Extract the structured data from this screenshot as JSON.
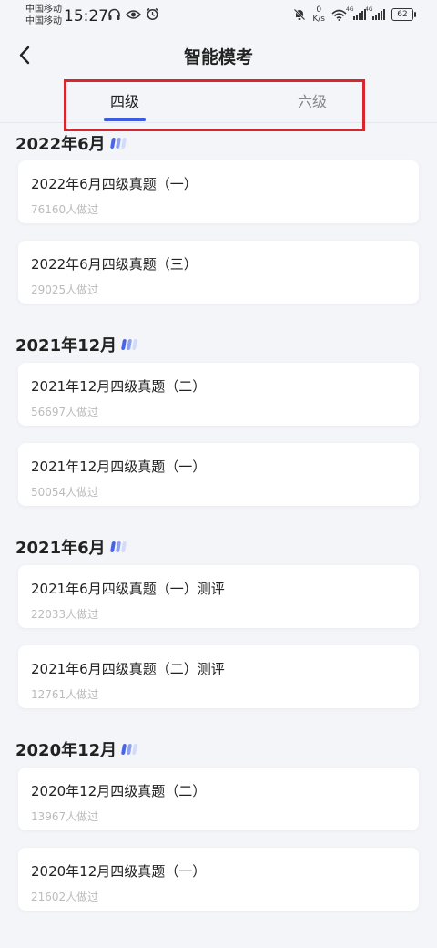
{
  "status_bar": {
    "carrier_1": "中国移动",
    "carrier_2": "中国移动",
    "time": "15:27",
    "net_speed_value": "0",
    "net_speed_unit": "K/s",
    "signal_label_1": "4G",
    "signal_label_2": "4G",
    "battery": "62"
  },
  "header": {
    "title": "智能模考"
  },
  "tabs": [
    {
      "label": "四级",
      "active": true
    },
    {
      "label": "六级",
      "active": false
    }
  ],
  "colors": {
    "accent": "#3d5ce0",
    "highlight": "#d9262e",
    "bar_1": "#4a64e6",
    "bar_2": "#8fa2f0",
    "bar_3": "#d3dbfb"
  },
  "sections": [
    {
      "title": "2022年6月",
      "items": [
        {
          "title": "2022年6月四级真题（一）",
          "count": "76160人做过"
        },
        {
          "title": "2022年6月四级真题（三）",
          "count": "29025人做过"
        }
      ]
    },
    {
      "title": "2021年12月",
      "items": [
        {
          "title": "2021年12月四级真题（二）",
          "count": "56697人做过"
        },
        {
          "title": "2021年12月四级真题（一）",
          "count": "50054人做过"
        }
      ]
    },
    {
      "title": "2021年6月",
      "items": [
        {
          "title": "2021年6月四级真题（一）测评",
          "count": "22033人做过"
        },
        {
          "title": "2021年6月四级真题（二）测评",
          "count": "12761人做过"
        }
      ]
    },
    {
      "title": "2020年12月",
      "items": [
        {
          "title": "2020年12月四级真题（二）",
          "count": "13967人做过"
        },
        {
          "title": "2020年12月四级真题（一）",
          "count": "21602人做过"
        }
      ]
    }
  ]
}
